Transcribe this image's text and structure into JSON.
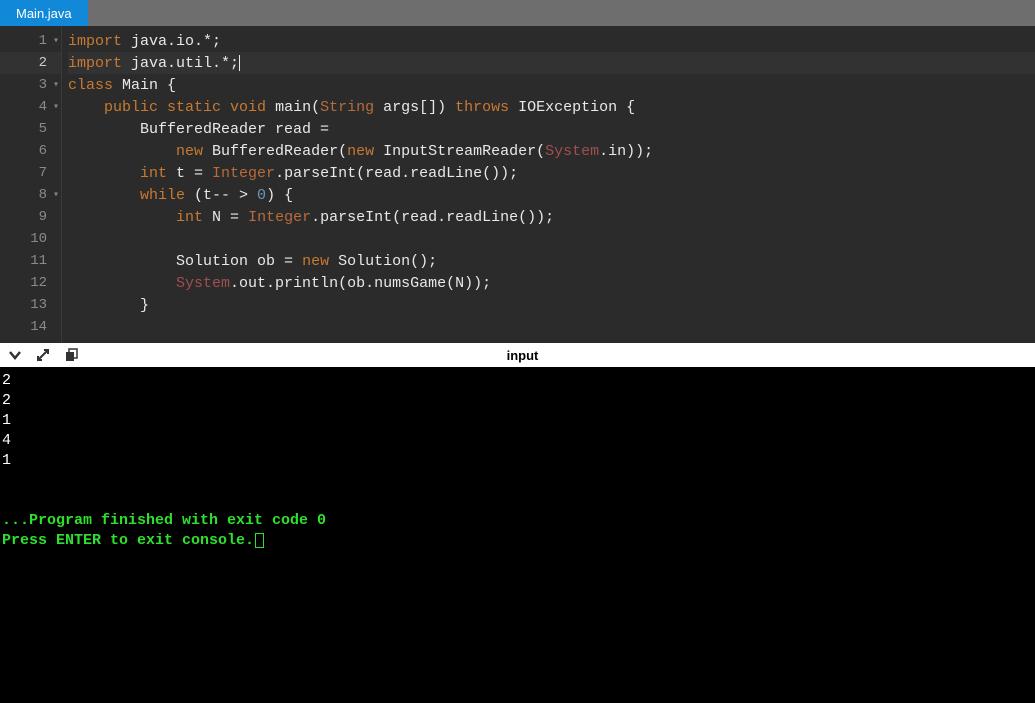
{
  "tabs": {
    "active": "Main.java"
  },
  "editor": {
    "lines": [
      {
        "num": 1,
        "fold": true
      },
      {
        "num": 2,
        "fold": false,
        "active": true
      },
      {
        "num": 3,
        "fold": true
      },
      {
        "num": 4,
        "fold": true
      },
      {
        "num": 5,
        "fold": false
      },
      {
        "num": 6,
        "fold": false
      },
      {
        "num": 7,
        "fold": false
      },
      {
        "num": 8,
        "fold": true
      },
      {
        "num": 9,
        "fold": false
      },
      {
        "num": 10,
        "fold": false
      },
      {
        "num": 11,
        "fold": false
      },
      {
        "num": 12,
        "fold": false
      },
      {
        "num": 13,
        "fold": false
      },
      {
        "num": 14,
        "fold": false
      }
    ],
    "code": {
      "l1": {
        "kw1": "import",
        "pkg": " java.io.*;"
      },
      "l2": {
        "kw1": "import",
        "pkg": " java.util.*;"
      },
      "l3": {
        "kw1": "class",
        "name": " Main {"
      },
      "l4": {
        "indent": "    ",
        "kw1": "public",
        "kw2": " static",
        "kw3": " void",
        "method": " main(",
        "type1": "String",
        "rest1": " args[]) ",
        "kw4": "throws",
        "rest2": " IOException {"
      },
      "l5": {
        "indent": "        ",
        "text": "BufferedReader read ="
      },
      "l6": {
        "indent": "            ",
        "kw1": "new",
        "rest1": " BufferedReader(",
        "kw2": "new",
        "rest2": " InputStreamReader(",
        "sys": "System",
        "rest3": ".in));"
      },
      "l7": {
        "indent": "        ",
        "kw1": "int",
        "rest1": " t = ",
        "type1": "Integer",
        "rest2": ".parseInt(read.readLine());"
      },
      "l8": {
        "indent": "        ",
        "kw1": "while",
        "rest1": " (t-- > ",
        "num": "0",
        "rest2": ") {"
      },
      "l9": {
        "indent": "            ",
        "kw1": "int",
        "rest1": " N = ",
        "type1": "Integer",
        "rest2": ".parseInt(read.readLine());"
      },
      "l10": {
        "indent": ""
      },
      "l11": {
        "indent": "            ",
        "text1": "Solution ob = ",
        "kw1": "new",
        "text2": " Solution();"
      },
      "l12": {
        "indent": "            ",
        "sys": "System",
        "rest": ".out.println(ob.numsGame(N));"
      },
      "l13": {
        "indent": "        ",
        "text": "}"
      }
    }
  },
  "terminal": {
    "label": "input",
    "output": [
      "2",
      "2",
      "1",
      "4",
      "1"
    ],
    "status1": "...Program finished with exit code 0",
    "status2": "Press ENTER to exit console."
  }
}
